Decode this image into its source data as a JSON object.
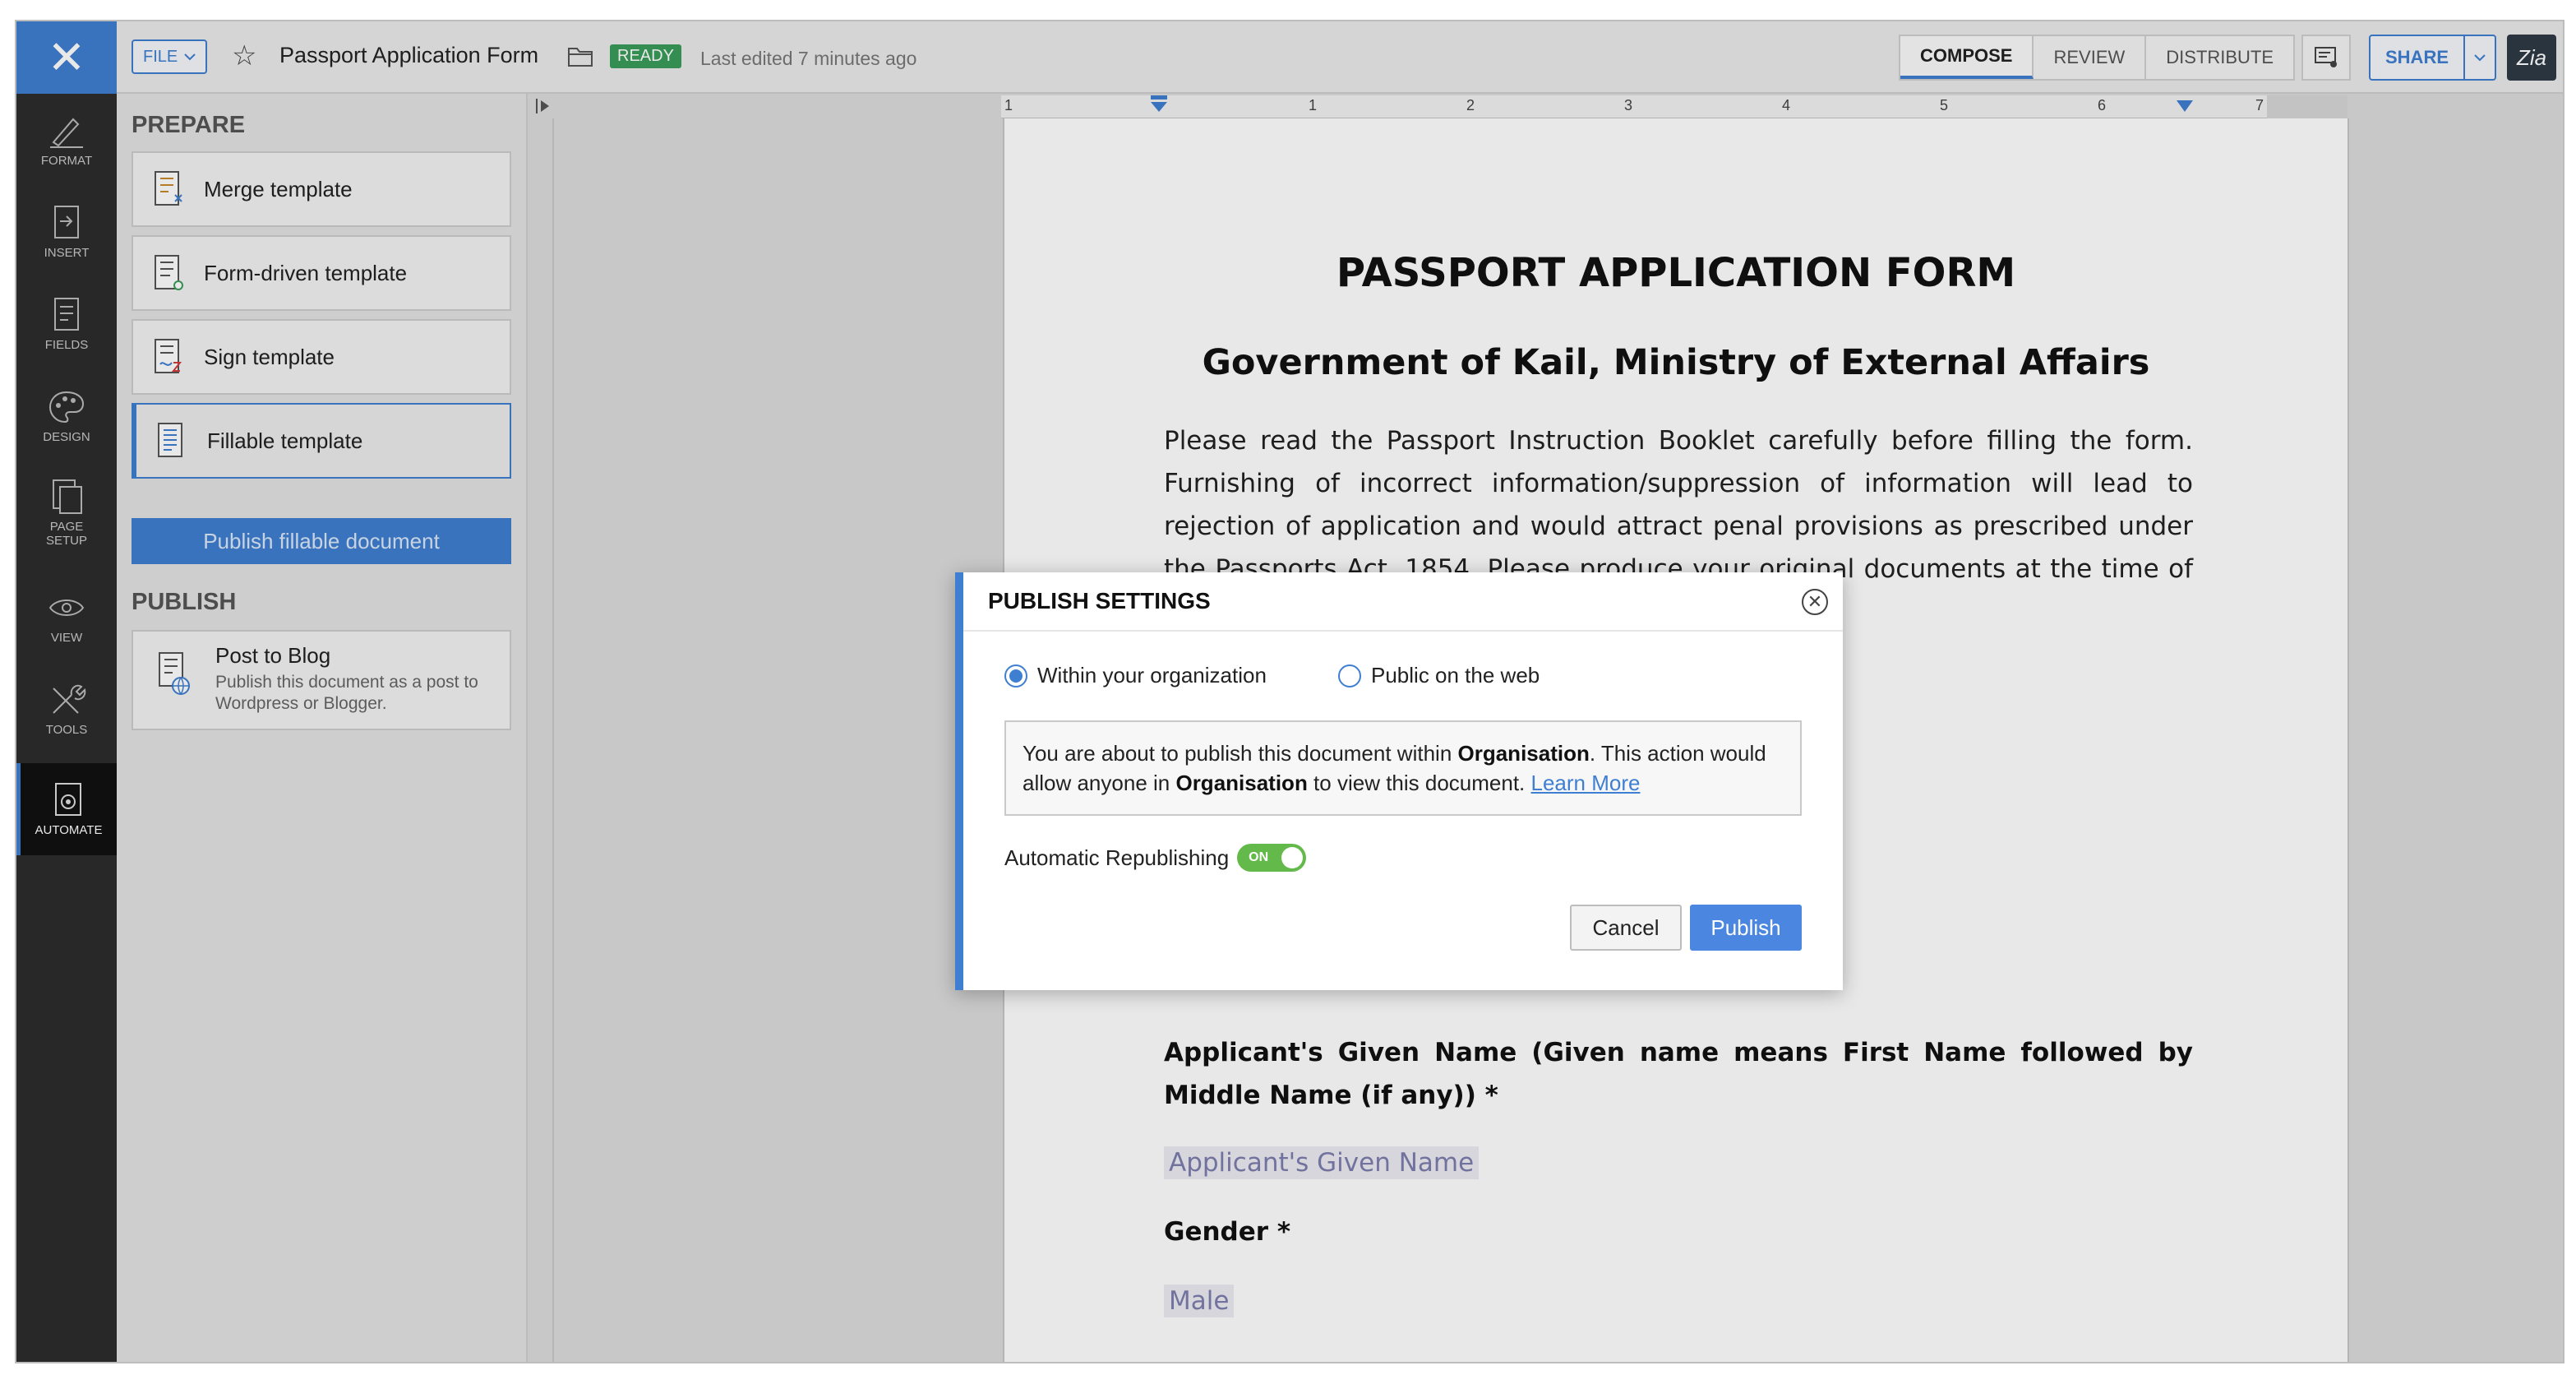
{
  "toolbar": {
    "close_icon": "close-icon",
    "file_label": "FILE",
    "doc_title": "Passport Application Form",
    "status_badge": "READY",
    "last_edited": "Last edited 7 minutes ago",
    "tabs": [
      {
        "label": "COMPOSE",
        "active": true
      },
      {
        "label": "REVIEW",
        "active": false
      },
      {
        "label": "DISTRIBUTE",
        "active": false
      }
    ],
    "share_label": "SHARE",
    "zia_label": "Zia",
    "accent_color": "#3f7fd1"
  },
  "leftnav": {
    "items": [
      {
        "label": "FORMAT",
        "icon": "format-pen-icon"
      },
      {
        "label": "INSERT",
        "icon": "insert-icon"
      },
      {
        "label": "FIELDS",
        "icon": "fields-icon"
      },
      {
        "label": "DESIGN",
        "icon": "palette-icon"
      },
      {
        "label": "PAGE SETUP",
        "icon": "page-setup-icon"
      },
      {
        "label": "VIEW",
        "icon": "eye-icon"
      },
      {
        "label": "TOOLS",
        "icon": "tools-icon"
      },
      {
        "label": "AUTOMATE",
        "icon": "automate-icon",
        "active": true
      }
    ]
  },
  "panel": {
    "prepare_title": "PREPARE",
    "templates": [
      {
        "label": "Merge template"
      },
      {
        "label": "Form-driven template"
      },
      {
        "label": "Sign template"
      },
      {
        "label": "Fillable template",
        "selected": true
      }
    ],
    "publish_fillable": "Publish fillable document",
    "publish_title": "PUBLISH",
    "post_blog_title": "Post to Blog",
    "post_blog_desc": "Publish this document as a post to Wordpress or Blogger."
  },
  "ruler": {
    "numbers": [
      "1",
      "1",
      "2",
      "3",
      "4",
      "5",
      "6",
      "7"
    ]
  },
  "document": {
    "title": "PASSPORT APPLICATION FORM",
    "subtitle": "Government of Kail, Ministry of External Affairs",
    "paragraph": "Please read the Passport Instruction Booklet carefully before filling the form. Furnishing of incorrect information/suppression of information will lead to rejection of application and would attract penal provisions as prescribed under the Passports Act, 1854. Please produce your original documents at the time of submission of the form. All fields marked with (*)",
    "given_name_label": "Applicant's Given Name (Given name means First Name followed by Middle Name (if any)) *",
    "given_name_field": "Applicant's Given Name",
    "gender_label": "Gender *",
    "gender_field": "Male"
  },
  "dialog": {
    "title": "PUBLISH SETTINGS",
    "option_org": "Within your organization",
    "option_public": "Public on the web",
    "selected_option": "org",
    "info_part1": "You are about to publish this document within ",
    "info_org1": "Organisation",
    "info_part2": ". This action would allow anyone in ",
    "info_org2": "Organisation",
    "info_part3": " to view this document. ",
    "learn_more": "Learn More",
    "auto_republish_label": "Automatic Republishing",
    "toggle_state": "ON",
    "cancel_label": "Cancel",
    "publish_label": "Publish"
  }
}
